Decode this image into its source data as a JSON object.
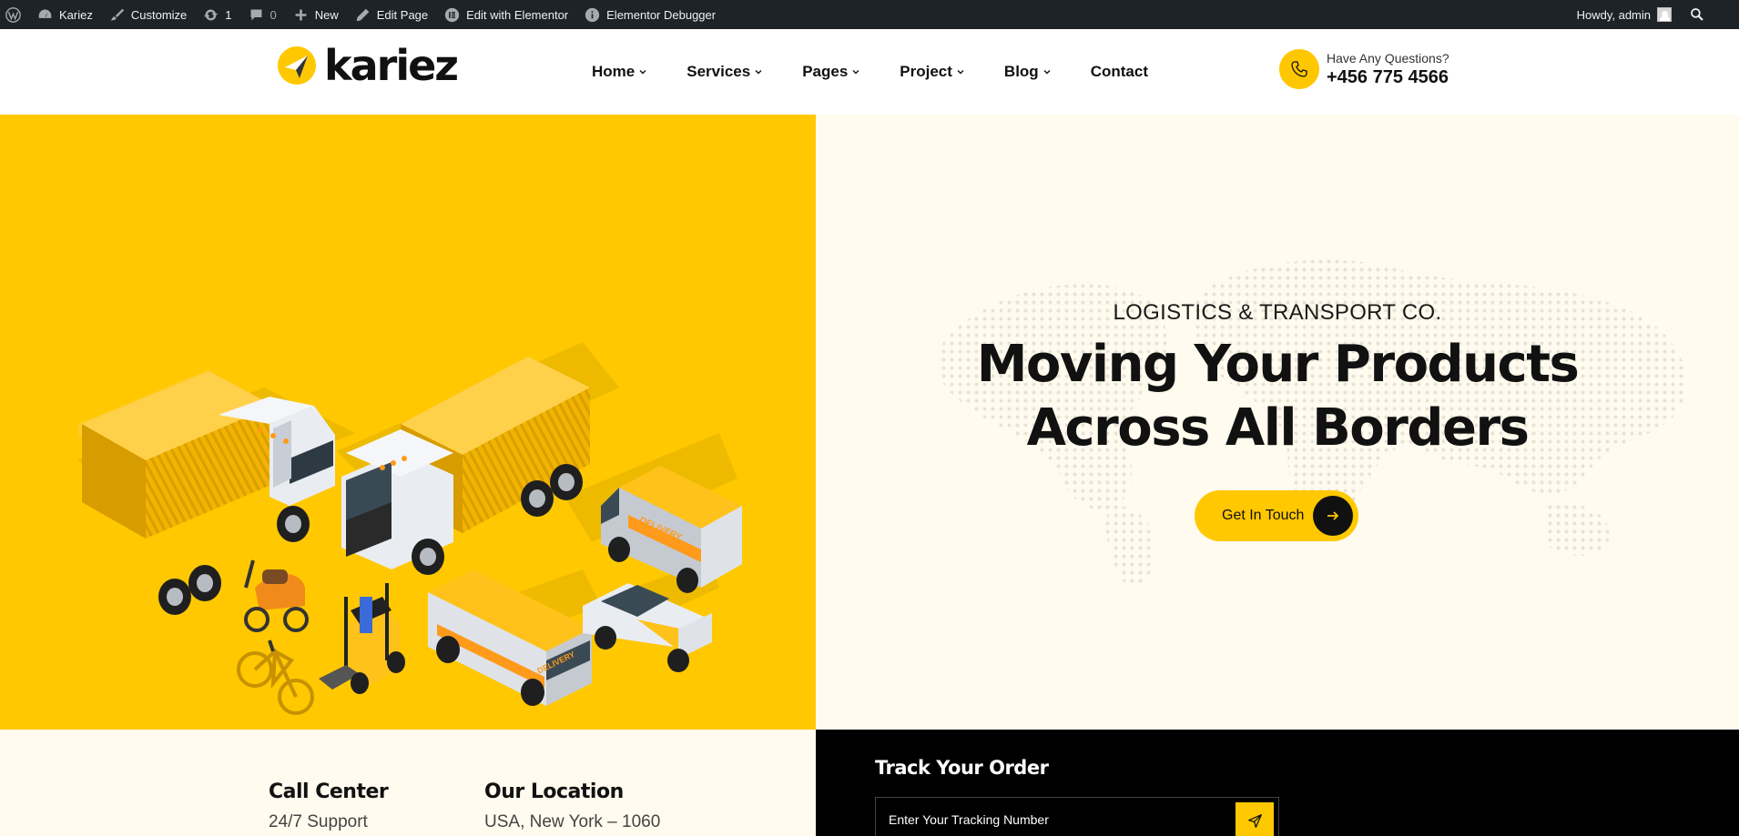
{
  "admin_bar": {
    "site_name": "Kariez",
    "customize": "Customize",
    "updates_count": "1",
    "comments_count": "0",
    "new_label": "New",
    "edit_page": "Edit Page",
    "edit_elementor": "Edit with Elementor",
    "debugger": "Elementor Debugger",
    "greeting": "Howdy, admin"
  },
  "header": {
    "logo_text": "kariez",
    "nav": [
      {
        "label": "Home",
        "has_dropdown": true
      },
      {
        "label": "Services",
        "has_dropdown": true
      },
      {
        "label": "Pages",
        "has_dropdown": true
      },
      {
        "label": "Project",
        "has_dropdown": true
      },
      {
        "label": "Blog",
        "has_dropdown": true
      },
      {
        "label": "Contact",
        "has_dropdown": false
      }
    ],
    "contact_label": "Have Any Questions?",
    "contact_phone": "+456 775 4566"
  },
  "hero": {
    "eyebrow": "LOGISTICS & TRANSPORT CO.",
    "headline_line1": "Moving Your Products",
    "headline_line2": "Across All Borders",
    "cta_label": "Get In Touch",
    "illustration_text": "DELIVERY"
  },
  "info": {
    "call_title": "Call Center",
    "call_sub": "24/7 Support",
    "location_title": "Our Location",
    "location_sub": "USA, New York – 1060"
  },
  "track": {
    "title": "Track Your Order",
    "placeholder": "Enter Your Tracking Number"
  },
  "colors": {
    "brand_yellow": "#ffc800",
    "admin_bar": "#1d2327",
    "cream": "#fffbee"
  }
}
